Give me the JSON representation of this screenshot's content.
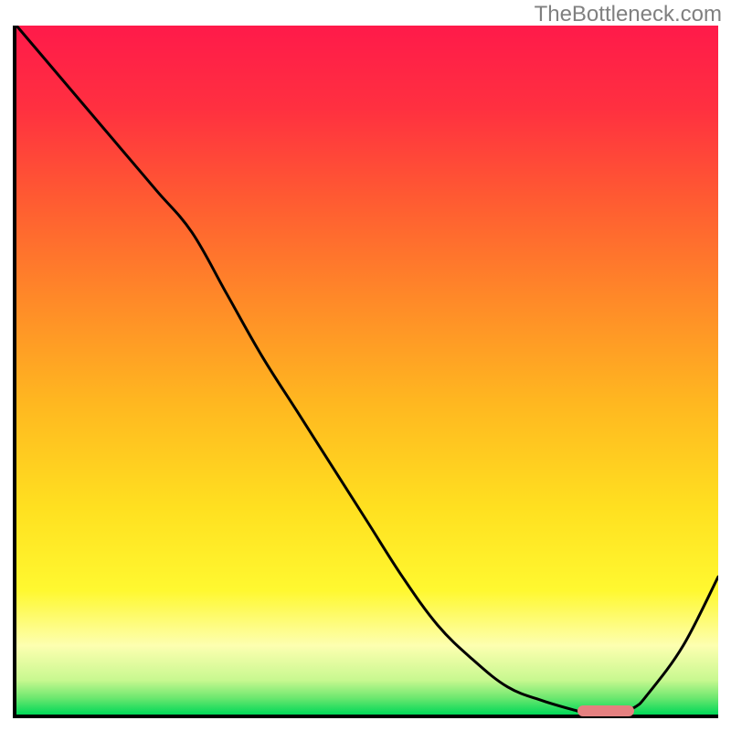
{
  "watermark": "TheBottleneck.com",
  "chart_data": {
    "type": "line",
    "title": "",
    "xlabel": "",
    "ylabel": "",
    "xlim": [
      0,
      100
    ],
    "ylim": [
      0,
      100
    ],
    "x": [
      0,
      5,
      10,
      15,
      20,
      25,
      30,
      35,
      40,
      45,
      50,
      55,
      60,
      65,
      70,
      75,
      80,
      82,
      85,
      88,
      90,
      95,
      100
    ],
    "values": [
      100,
      94,
      88,
      82,
      76,
      70,
      61,
      52,
      44,
      36,
      28,
      20,
      13,
      8,
      4,
      2,
      0.5,
      0,
      0,
      1,
      3,
      10,
      20
    ],
    "gradient_stops": [
      {
        "pos": 0.0,
        "color": "#ff1a4a"
      },
      {
        "pos": 0.12,
        "color": "#ff3040"
      },
      {
        "pos": 0.25,
        "color": "#ff5a32"
      },
      {
        "pos": 0.4,
        "color": "#ff8a28"
      },
      {
        "pos": 0.55,
        "color": "#ffb820"
      },
      {
        "pos": 0.7,
        "color": "#ffe020"
      },
      {
        "pos": 0.82,
        "color": "#fff830"
      },
      {
        "pos": 0.9,
        "color": "#fdffb0"
      },
      {
        "pos": 0.95,
        "color": "#c8f890"
      },
      {
        "pos": 0.975,
        "color": "#70e870"
      },
      {
        "pos": 1.0,
        "color": "#00d858"
      }
    ],
    "bottom_marker": {
      "x_start": 80,
      "x_end": 88,
      "color": "#e58080"
    }
  }
}
